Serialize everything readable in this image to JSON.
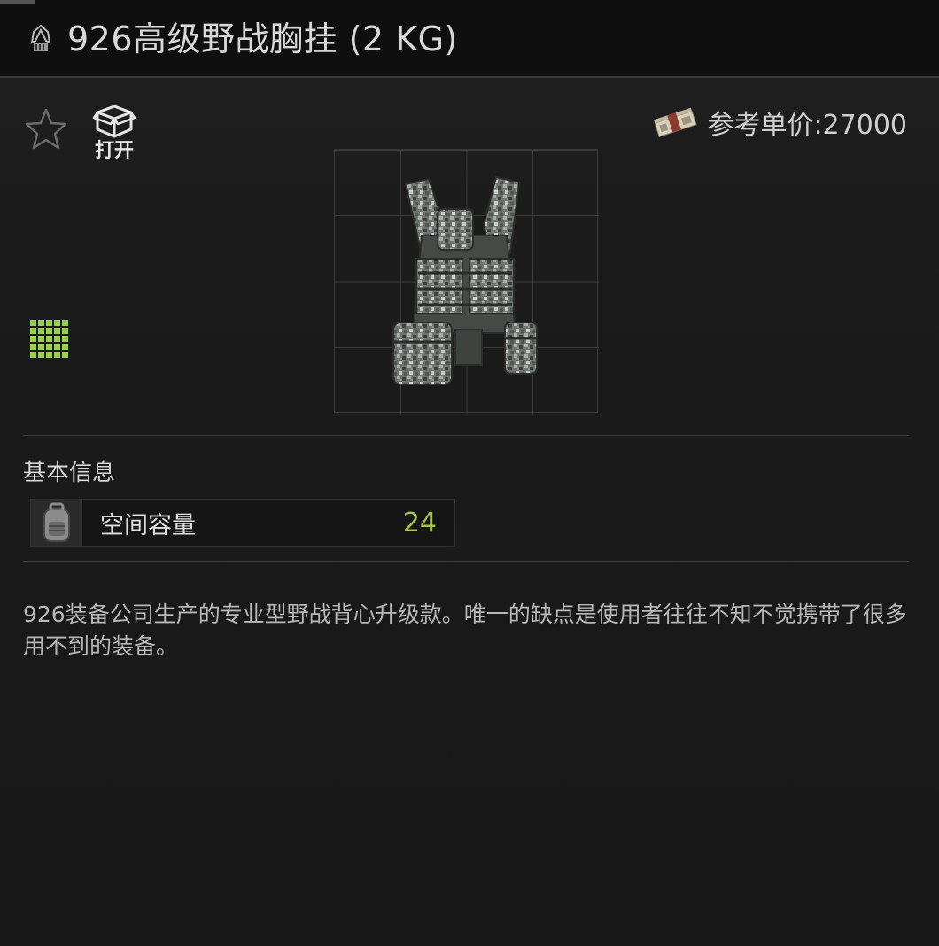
{
  "header": {
    "title": "926高级野战胸挂 (2 KG)",
    "title_icon": "weight-icon"
  },
  "toolbar": {
    "favorite_icon": "star-icon",
    "open_label": "打开",
    "open_icon": "open-box-icon"
  },
  "price": {
    "label": "参考单价:27000",
    "icon": "money-icon"
  },
  "item": {
    "grid_icon": "inventory-grid-icon",
    "image": "tactical-vest-icon",
    "grid_size": "4x4"
  },
  "basic_info": {
    "title": "基本信息",
    "stats": [
      {
        "icon": "backpack-icon",
        "label": "空间容量",
        "value": "24"
      }
    ]
  },
  "description": "926装备公司生产的专业型野战背心升级款。唯一的缺点是使用者往往不知不觉携带了很多用不到的装备。",
  "colors": {
    "background": "#1a1a1a",
    "title_bar": "#0f0f0f",
    "accent_green": "#a6c44a",
    "text": "#cfcfcf"
  }
}
